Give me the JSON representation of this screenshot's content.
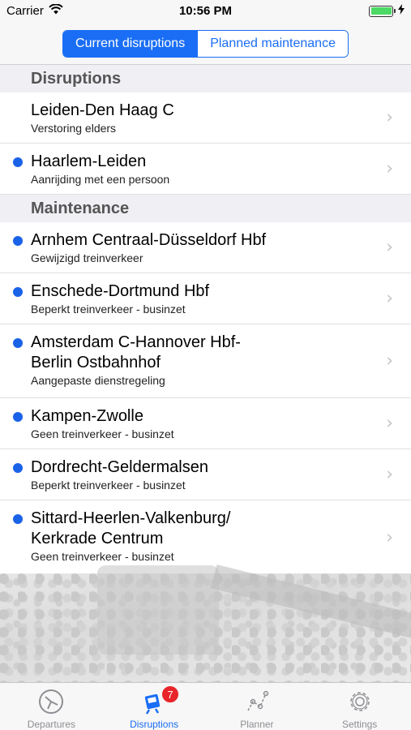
{
  "status_bar": {
    "carrier": "Carrier",
    "time": "10:56 PM"
  },
  "segmented_control": {
    "options": [
      "Current disruptions",
      "Planned maintenance"
    ],
    "selected": "Current disruptions"
  },
  "sections": [
    {
      "header": "Disruptions",
      "rows": [
        {
          "title": "Leiden-Den Haag C",
          "subtitle": "Verstoring elders",
          "unread": false
        },
        {
          "title": "Haarlem-Leiden",
          "subtitle": "Aanrijding met een persoon",
          "unread": true
        }
      ]
    },
    {
      "header": "Maintenance",
      "rows": [
        {
          "title": "Arnhem Centraal-Düsseldorf Hbf",
          "subtitle": "Gewijzigd treinverkeer",
          "unread": true
        },
        {
          "title": "Enschede-Dortmund Hbf",
          "subtitle": "Beperkt treinverkeer - businzet",
          "unread": true
        },
        {
          "title_lines": [
            "Amsterdam C-Hannover Hbf-",
            "Berlin Ostbahnhof"
          ],
          "subtitle": "Aangepaste dienstregeling",
          "unread": true
        },
        {
          "title": "Kampen-Zwolle",
          "subtitle": "Geen treinverkeer - businzet",
          "unread": true
        },
        {
          "title": "Dordrecht-Geldermalsen",
          "subtitle": "Beperkt treinverkeer - businzet",
          "unread": true
        },
        {
          "title_lines": [
            "Sittard-Heerlen-Valkenburg/",
            "Kerkrade Centrum"
          ],
          "subtitle": "Geen treinverkeer - businzet",
          "unread": true
        }
      ]
    }
  ],
  "tab_bar": {
    "tabs": [
      {
        "label": "Departures",
        "icon": "clock-icon"
      },
      {
        "label": "Disruptions",
        "icon": "disruptions-icon",
        "badge": "7",
        "active": true
      },
      {
        "label": "Planner",
        "icon": "route-icon"
      },
      {
        "label": "Settings",
        "icon": "gear-icon"
      }
    ]
  },
  "colors": {
    "accent": "#1a6ef5",
    "unread_dot": "#1a62e8",
    "badge": "#e8252a"
  }
}
